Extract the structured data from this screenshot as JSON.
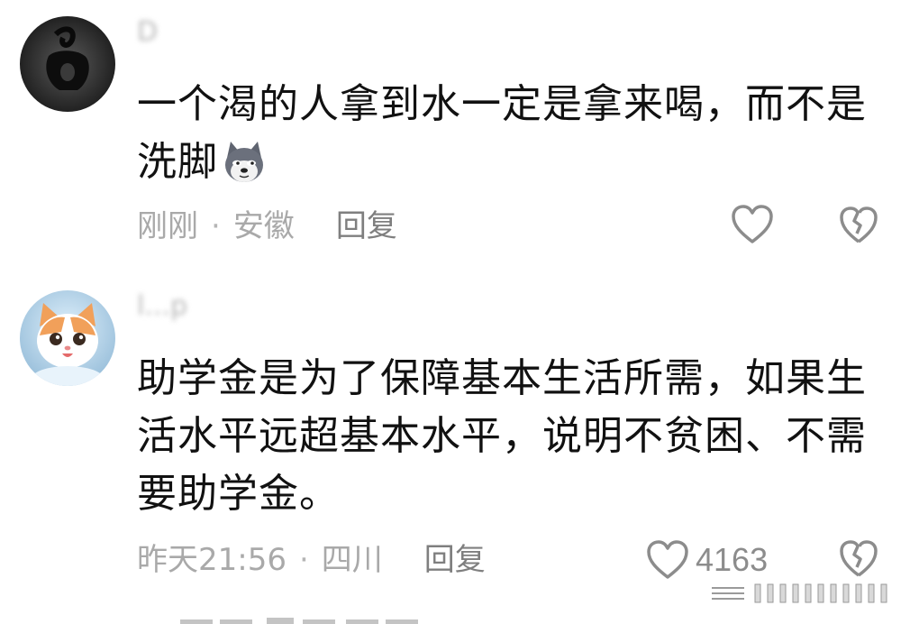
{
  "comments": [
    {
      "username": "D",
      "text_lines": [
        "一个渴的人拿到水一定是拿来喝，而不是",
        "洗脚"
      ],
      "emoji_icon": "husky-dog-emoji-icon",
      "time": "刚刚",
      "location": "安徽",
      "reply_label": "回复",
      "like_count": ""
    },
    {
      "username": "l...p",
      "text_lines": [
        "助学金是为了保障基本生活所需，如果生",
        "活水平远超基本水平，说明不贫困、不需",
        "要助学金。"
      ],
      "time": "昨天21:56",
      "location": "四川",
      "reply_label": "回复",
      "like_count": "4163"
    }
  ],
  "separator": "·",
  "icons": {
    "like": "heart-outline-icon",
    "dislike": "broken-heart-icon"
  },
  "colors": {
    "text": "#111111",
    "meta": "#a9a9a9",
    "icon": "#8c8c8c"
  }
}
